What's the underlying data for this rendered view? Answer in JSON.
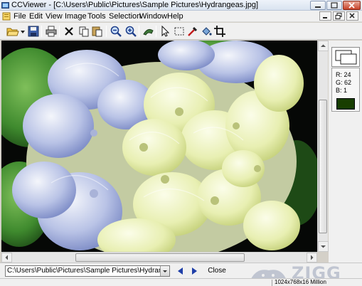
{
  "window": {
    "title": "CCViewer - [C:\\Users\\Public\\Pictures\\Sample Pictures\\Hydrangeas.jpg]"
  },
  "menu": {
    "items": [
      "File",
      "Edit",
      "View",
      "Image",
      "Tools",
      "Selection",
      "Window",
      "Help"
    ]
  },
  "toolbar": {
    "buttons": [
      "open-folder",
      "save",
      "print",
      "delete",
      "copy",
      "paste",
      "zoom-out",
      "zoom-in",
      "rotate",
      "select-arrow",
      "rect-select",
      "eyedropper",
      "fill",
      "crop"
    ]
  },
  "image": {
    "subject": "Hydrangeas",
    "scroll_horizontal_fraction": 0.33,
    "scroll_vertical_fraction": 0.3
  },
  "color_picker": {
    "r_label": "R: 24",
    "g_label": "G: 62",
    "b_label": "B: 1",
    "swatch_color": "#183e01"
  },
  "bottom": {
    "path": "C:\\Users\\Public\\Pictures\\Sample Pictures\\Hydrangeas.jpg",
    "close_label": "Close",
    "watermark": "ZIGG"
  },
  "status": {
    "info": "1024x768x16 Million"
  },
  "colors": {
    "nav_arrow": "#1f3fa8",
    "title_bg": "#dfe8f3"
  }
}
